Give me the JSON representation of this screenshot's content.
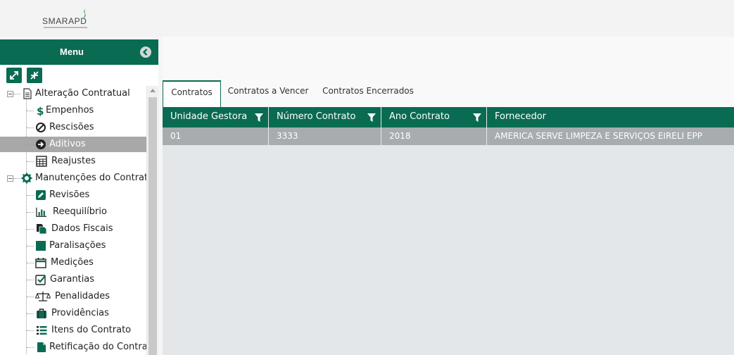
{
  "header": {
    "logo_text": "SMARAPD"
  },
  "sidebar": {
    "menu_title": "Menu",
    "tree": [
      {
        "label": "Alteração Contratual",
        "icon": "document-icon",
        "group": true
      },
      {
        "label": "Empenhos",
        "icon": "dollar-icon"
      },
      {
        "label": "Rescisões",
        "icon": "ban-icon"
      },
      {
        "label": "Aditivos",
        "icon": "arrow-right-circle-icon",
        "selected": true
      },
      {
        "label": "Reajustes",
        "icon": "calculator-icon"
      },
      {
        "label": "Manutenções do Contrato",
        "icon": "gear-icon",
        "group": true
      },
      {
        "label": "Revisões",
        "icon": "edit-icon"
      },
      {
        "label": "Reequilíbrio",
        "icon": "bar-chart-icon"
      },
      {
        "label": "Dados Fiscais",
        "icon": "files-icon"
      },
      {
        "label": "Paralisações",
        "icon": "stop-icon"
      },
      {
        "label": "Medições",
        "icon": "calendar-icon"
      },
      {
        "label": "Garantias",
        "icon": "check-square-icon"
      },
      {
        "label": "Penalidades",
        "icon": "balance-scale-icon"
      },
      {
        "label": "Providências",
        "icon": "briefcase-icon"
      },
      {
        "label": "Itens do Contrato",
        "icon": "list-icon"
      },
      {
        "label": "Retificação do Contrato",
        "icon": "file-icon"
      }
    ]
  },
  "tabs": [
    {
      "label": "Contratos",
      "active": true
    },
    {
      "label": "Contratos a Vencer"
    },
    {
      "label": "Contratos Encerrados"
    }
  ],
  "grid": {
    "columns": [
      "Unidade Gestora",
      "Número Contrato",
      "Ano Contrato",
      "Fornecedor"
    ],
    "rows": [
      [
        "01",
        "3333",
        "2018",
        "AMERICA SERVE LIMPEZA E SERVIÇOS EIRELI EPP"
      ]
    ]
  },
  "colors": {
    "accent": "#0a6b53",
    "selected_row": "#a8a8a8",
    "grid_bg": "#e4e7e9"
  }
}
